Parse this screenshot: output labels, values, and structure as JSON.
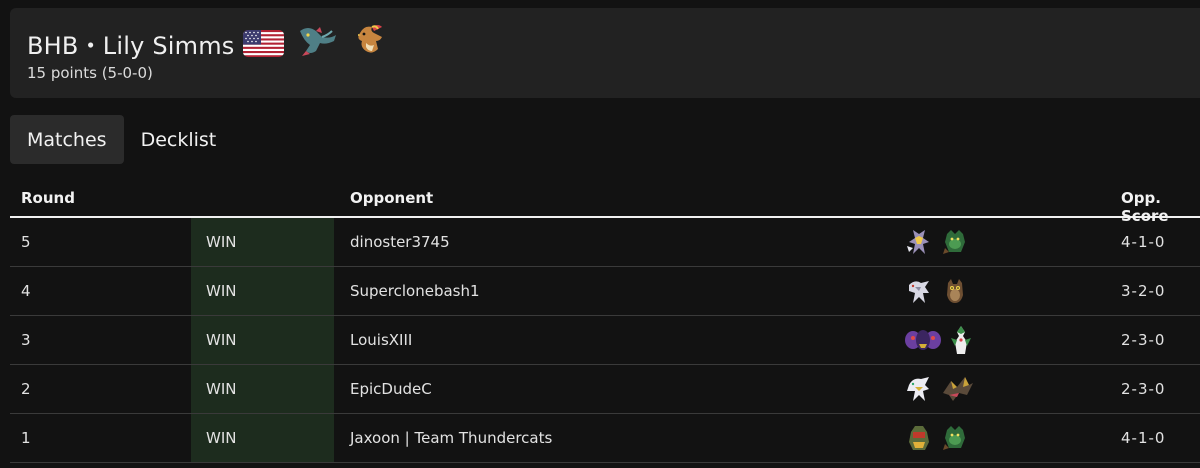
{
  "header": {
    "player_name": "BHB・Lily Simms",
    "flag_icon": "us-flag-icon",
    "deck_icons": [
      "dragapult-sprite-icon",
      "pidgeot-sprite-icon"
    ],
    "points": "15 points (5-0-0)"
  },
  "tabs": [
    {
      "label": "Matches",
      "active": true
    },
    {
      "label": "Decklist",
      "active": false
    }
  ],
  "table": {
    "headers": {
      "round": "Round",
      "opponent": "Opponent",
      "opp_score": "Opp. Score"
    },
    "rows": [
      {
        "round": "5",
        "result": "WIN",
        "opponent": "dinoster3745",
        "deck_icons": [
          "zeraora-sprite-icon",
          "rillaboom-sprite-icon"
        ],
        "score": "4-1-0"
      },
      {
        "round": "4",
        "result": "WIN",
        "opponent": "Superclonebash1",
        "deck_icons": [
          "arceus-sprite-icon",
          "noctowl-sprite-icon"
        ],
        "score": "3-2-0"
      },
      {
        "round": "3",
        "result": "WIN",
        "opponent": "LouisXIII",
        "deck_icons": [
          "cofagrigus-sprite-icon",
          "gallade-sprite-icon"
        ],
        "score": "2-3-0"
      },
      {
        "round": "2",
        "result": "WIN",
        "opponent": "EpicDudeC",
        "deck_icons": [
          "arceus-sprite-icon",
          "giratina-sprite-icon"
        ],
        "score": "2-3-0"
      },
      {
        "round": "1",
        "result": "WIN",
        "opponent": "Jaxoon | Team Thundercats",
        "deck_icons": [
          "iron-thorns-sprite-icon",
          "rillaboom-sprite-icon"
        ],
        "score": "4-1-0"
      }
    ]
  },
  "colors": {
    "background": "#121212",
    "header_card": "#222222",
    "win_cell": "#1d2c1e",
    "text": "#e6e6e6"
  }
}
